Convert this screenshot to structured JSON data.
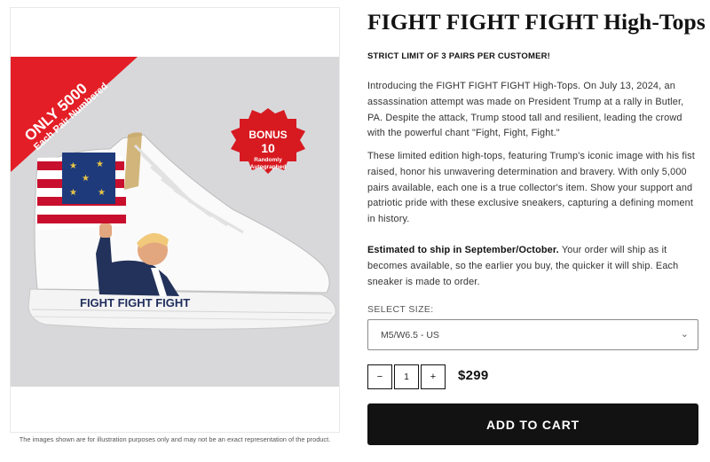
{
  "product": {
    "title": "FIGHT FIGHT FIGHT High-Tops",
    "limit_notice": "STRICT LIMIT OF 3 PAIRS PER CUSTOMER!",
    "description_1": "Introducing the FIGHT FIGHT FIGHT High-Tops. On July 13, 2024, an assassination attempt was made on President Trump at a rally in Butler, PA. Despite the attack, Trump stood tall and resilient, leading the crowd with the powerful chant \"Fight, Fight, Fight.\"",
    "description_2": "These limited edition high-tops, featuring Trump's iconic image with his fist raised, honor his unwavering determination and bravery. With only 5,000 pairs available, each one is a true collector's item. Show your support and patriotic pride with these exclusive sneakers, capturing a defining moment in history.",
    "shipping_bold": "Estimated to ship in September/October.",
    "shipping_text": " Your order will ship as it becomes available, so the earlier you buy, the quicker it will ship. Each sneaker is made to order.",
    "price": "$299"
  },
  "size": {
    "label": "SELECT SIZE:",
    "selected": "M5/W6.5 - US"
  },
  "quantity": {
    "minus": "−",
    "value": "1",
    "plus": "+"
  },
  "cart": {
    "button_label": "ADD TO CART"
  },
  "image": {
    "banner_line1": "ONLY 5000",
    "banner_line2": "Each Pair Numbered",
    "badge_line1": "BONUS",
    "badge_line2": "10",
    "badge_line3": "Randomly",
    "badge_line4": "Autographed",
    "shoe_text": "FIGHT FIGHT FIGHT",
    "disclaimer": "The images shown are for illustration purposes only and may not be an exact representation of the product."
  },
  "colors": {
    "banner_red": "#e41e26",
    "badge_red": "#d71920",
    "flag_blue": "#1e3a7a",
    "text_navy": "#1f2d5c",
    "button_black": "#121212"
  },
  "icons": {
    "select_chevron": "chevron-down-icon"
  }
}
